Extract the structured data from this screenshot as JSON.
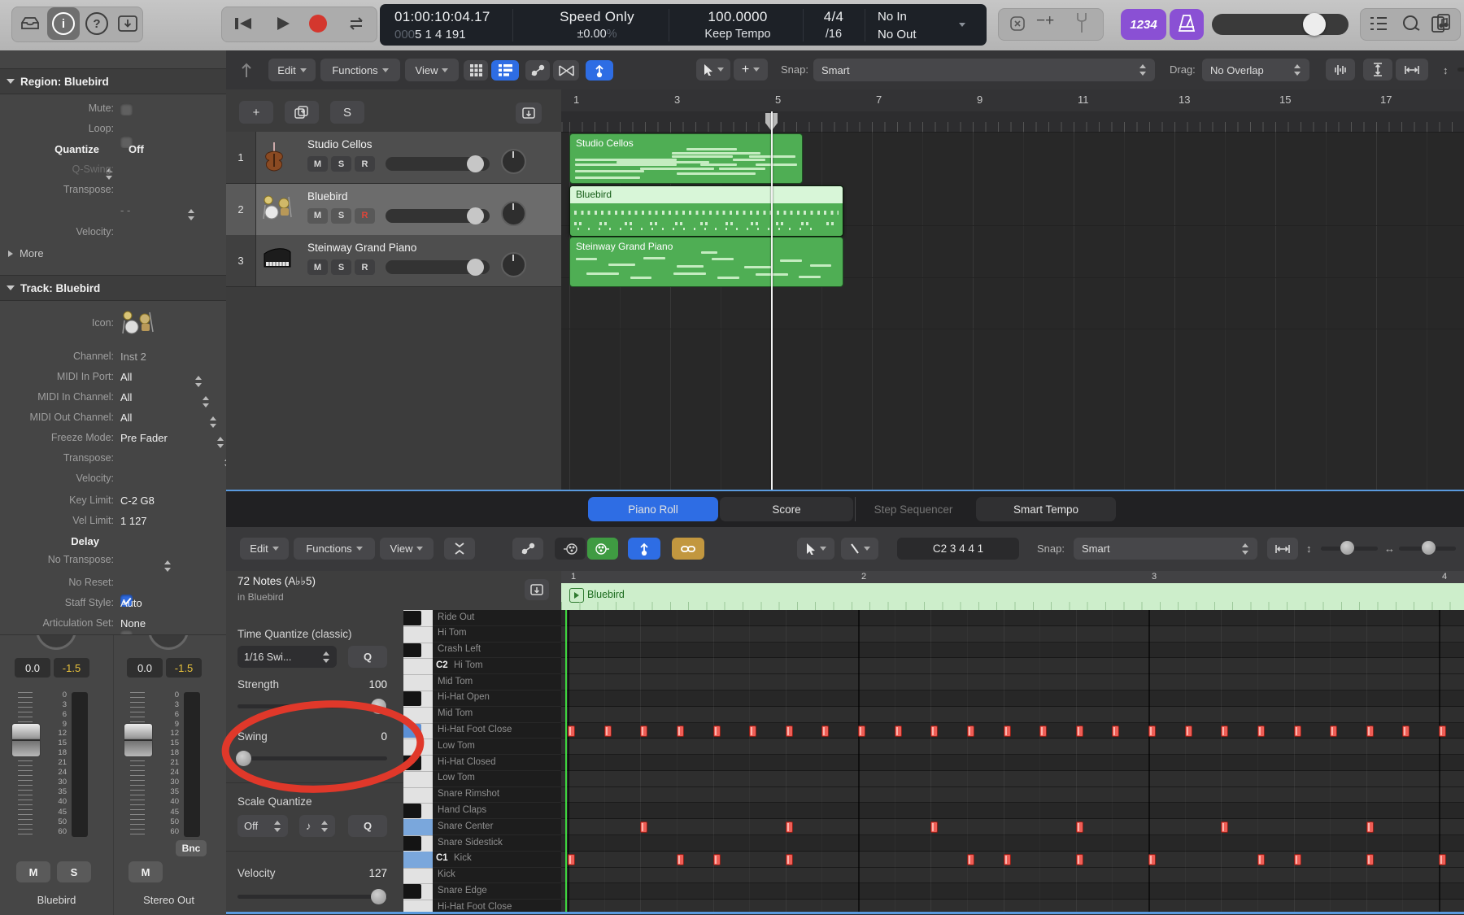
{
  "colors": {
    "accent_blue": "#2e6de4",
    "accent_purple": "#8a50d4",
    "region_green": "#4fae54",
    "region_green_selected_header": "#d8f6d8",
    "note_red": "#ef5d55",
    "annotation_red": "#e0382a",
    "lcd_bg": "#1d2127",
    "playhead_green": "#3ed43e"
  },
  "top_toolbar": {
    "lcd": {
      "position_primary": "01:00:10:04.17",
      "position_zeros": "000",
      "position_secondary": "5 1 4 191",
      "speed_label": "Speed Only",
      "speed_value": "±0.00",
      "speed_unit": "%",
      "tempo_value": "100.0000",
      "tempo_mode": "Keep Tempo",
      "time_signature": "4/4",
      "division": "/16",
      "midi_in": "No In",
      "midi_out": "No Out"
    },
    "count_in_label": "1234"
  },
  "inspector": {
    "region_section": {
      "title": "Region: Bluebird",
      "more_label": "More",
      "rows": [
        {
          "label": "Mute:",
          "checkbox": "unchecked"
        },
        {
          "label": "Loop:",
          "checkbox": "unchecked"
        },
        {
          "label": "Quantize",
          "value": "Off",
          "bold": true,
          "mid_stepper": true
        },
        {
          "label": "Q-Swing:",
          "dim": true
        },
        {
          "label": "Transpose:",
          "right_stepper": true
        },
        {
          "label": "",
          "value": "- -",
          "dashes": true
        },
        {
          "label": "Velocity:"
        }
      ]
    },
    "track_section": {
      "title": "Track: Bluebird",
      "icon_label": "Icon:",
      "rows": [
        {
          "label": "Channel:",
          "value": "Inst 2",
          "dim_value": true,
          "right_stepper": true
        },
        {
          "label": "MIDI In Port:",
          "value": "All",
          "right_stepper": true
        },
        {
          "label": "MIDI In Channel:",
          "value": "All",
          "right_stepper": true
        },
        {
          "label": "MIDI Out Channel:",
          "value": "All",
          "right_stepper": true
        },
        {
          "label": "Freeze Mode:",
          "value": "Pre Fader",
          "right_stepper": true
        },
        {
          "label": "Transpose:",
          "right_stepper": true
        },
        {
          "label": "Velocity:"
        },
        {
          "label": "Key Limit:",
          "value": "C-2  G8"
        },
        {
          "label": "Vel Limit:",
          "value": "1  127"
        },
        {
          "label": "Delay",
          "bold": true,
          "mid_stepper": true
        },
        {
          "label": "No Transpose:",
          "checkbox": "checked"
        },
        {
          "label": "No Reset:",
          "checkbox": "unchecked"
        },
        {
          "label": "Staff Style:",
          "value": "Auto",
          "right_stepper": true
        },
        {
          "label": "Articulation Set:",
          "value": "None",
          "right_stepper": true
        }
      ]
    },
    "fader_scale": [
      "0",
      "3",
      "6",
      "9",
      "12",
      "15",
      "18",
      "21",
      "24",
      "30",
      "35",
      "40",
      "45",
      "50",
      "60"
    ],
    "channel_strips": [
      {
        "gain": "0.0",
        "offset": "-1.5",
        "buttons": [
          "M",
          "S"
        ],
        "name": "Bluebird"
      },
      {
        "gain": "0.0",
        "offset": "-1.5",
        "bounce_label": "Bnc",
        "buttons": [
          "M"
        ],
        "name": "Stereo Out"
      }
    ]
  },
  "tracks_toolbar": {
    "menus": [
      "Edit",
      "Functions",
      "View"
    ],
    "snap_label": "Snap:",
    "snap_value": "Smart",
    "drag_label": "Drag:",
    "drag_value": "No Overlap"
  },
  "track_list": {
    "tracks": [
      {
        "number": "1",
        "name": "Studio Cellos",
        "buttons": [
          "M",
          "S",
          "R"
        ],
        "record_active": false,
        "icon": "cello-icon",
        "selected": false
      },
      {
        "number": "2",
        "name": "Bluebird",
        "buttons": [
          "M",
          "S",
          "R"
        ],
        "record_active": true,
        "icon": "drum-kit-icon",
        "selected": true
      },
      {
        "number": "3",
        "name": "Steinway Grand Piano",
        "buttons": [
          "M",
          "S",
          "R"
        ],
        "record_active": false,
        "icon": "piano-icon",
        "selected": false
      }
    ]
  },
  "arrange": {
    "ruler_numbers": [
      "1",
      "3",
      "5",
      "7",
      "9",
      "11",
      "13",
      "15",
      "17"
    ],
    "playhead_bar": 5,
    "regions": [
      {
        "name": "Studio Cellos",
        "start_bar": 1,
        "end_bar": 5.6,
        "selected": false,
        "preview": [
          [
            2,
            50,
            44
          ],
          [
            2,
            60,
            44
          ],
          [
            2,
            74,
            30
          ],
          [
            44,
            44,
            26
          ],
          [
            44,
            36,
            30
          ],
          [
            20,
            55,
            40
          ],
          [
            50,
            28,
            22
          ],
          [
            62,
            36,
            20
          ],
          [
            70,
            50,
            14
          ],
          [
            77,
            44,
            20
          ],
          [
            80,
            60,
            18
          ],
          [
            56,
            60,
            16
          ],
          [
            30,
            68,
            32
          ],
          [
            64,
            68,
            20
          ],
          [
            2,
            86,
            28
          ],
          [
            46,
            78,
            34
          ]
        ]
      },
      {
        "name": "Bluebird",
        "start_bar": 1,
        "end_bar": 6.4,
        "selected": true,
        "preview": []
      },
      {
        "name": "Steinway Grand Piano",
        "start_bar": 1,
        "end_bar": 6.4,
        "selected": false,
        "preview": [
          [
            2,
            42,
            8
          ],
          [
            14,
            54,
            10
          ],
          [
            27,
            40,
            8
          ],
          [
            39,
            56,
            10
          ],
          [
            52,
            42,
            8
          ],
          [
            64,
            58,
            10
          ],
          [
            77,
            45,
            8
          ],
          [
            88,
            55,
            8
          ],
          [
            6,
            72,
            12
          ],
          [
            22,
            80,
            8
          ],
          [
            38,
            72,
            12
          ],
          [
            54,
            80,
            8
          ],
          [
            68,
            74,
            12
          ],
          [
            84,
            78,
            8
          ],
          [
            48,
            28,
            6
          ]
        ]
      }
    ]
  },
  "piano_roll": {
    "tabs": [
      {
        "label": "Piano Roll",
        "selected": true
      },
      {
        "label": "Score",
        "selected": false
      },
      {
        "label": "Step Sequencer",
        "disabled": true
      },
      {
        "label": "Smart Tempo",
        "selected": false
      }
    ],
    "toolbar": {
      "menus": [
        "Edit",
        "Functions",
        "View"
      ],
      "position_display": "C2  3 4 4 1",
      "snap_label": "Snap:",
      "snap_value": "Smart"
    },
    "header": {
      "title": "72 Notes (A♭♭5)",
      "subtitle": "in Bluebird"
    },
    "quantize_panel": {
      "time_quantize_label": "Time Quantize (classic)",
      "time_quantize_value": "1/16 Swi...",
      "q_button": "Q",
      "strength_label": "Strength",
      "strength_value": "100",
      "swing_label": "Swing",
      "swing_value": "0",
      "scale_quantize_label": "Scale Quantize",
      "scale_quantize_value": "Off",
      "root_note_glyph": "♪",
      "velocity_label": "Velocity",
      "velocity_value": "127"
    },
    "ruler_numbers": [
      "1",
      "2",
      "3",
      "4"
    ],
    "region_bar_name": "Bluebird",
    "lanes": [
      {
        "name": "Ride Out",
        "key": "black"
      },
      {
        "name": "Hi Tom",
        "key": "white"
      },
      {
        "name": "Crash Left",
        "key": "black"
      },
      {
        "name": "Hi Tom",
        "key": "white",
        "octave": "C2"
      },
      {
        "name": "Mid Tom",
        "key": "white"
      },
      {
        "name": "Hi-Hat Open",
        "key": "black"
      },
      {
        "name": "Mid Tom",
        "key": "white"
      },
      {
        "name": "Hi-Hat Foot Close",
        "key": "black",
        "selected": true
      },
      {
        "name": "Low Tom",
        "key": "white"
      },
      {
        "name": "Hi-Hat Closed",
        "key": "black"
      },
      {
        "name": "Low Tom",
        "key": "white"
      },
      {
        "name": "Snare Rimshot",
        "key": "white"
      },
      {
        "name": "Hand Claps",
        "key": "black"
      },
      {
        "name": "Snare Center",
        "key": "white",
        "selected": true
      },
      {
        "name": "Snare Sidestick",
        "key": "black"
      },
      {
        "name": "Kick",
        "key": "white",
        "octave": "C1",
        "selected": true
      },
      {
        "name": "Kick",
        "key": "white"
      },
      {
        "name": "Snare Edge",
        "key": "black"
      },
      {
        "name": "Hi-Hat Foot Close",
        "key": "white"
      }
    ],
    "notes": {
      "units": "bars",
      "hi_hat_foot_close": [
        1,
        1.125,
        1.25,
        1.375,
        1.5,
        1.625,
        1.75,
        1.875,
        2,
        2.125,
        2.25,
        2.375,
        2.5,
        2.625,
        2.75,
        2.875,
        3,
        3.125,
        3.25,
        3.375,
        3.5,
        3.625,
        3.75,
        3.875,
        4
      ],
      "snare_center": [
        1.25,
        1.75,
        2.25,
        2.75,
        3.25,
        3.75
      ],
      "kick": [
        1,
        1.375,
        1.5,
        1.75,
        2.375,
        2.5,
        2.75,
        3,
        3.375,
        3.5,
        3.75,
        4
      ]
    }
  }
}
